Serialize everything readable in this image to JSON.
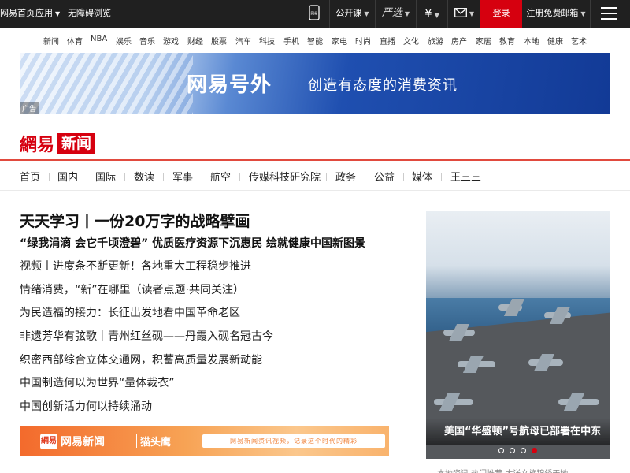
{
  "topbar": {
    "home": "网易首页",
    "apps": "应用",
    "accessible": "无障碍浏览",
    "phone_label": "网易",
    "open_course": "公开课",
    "yanxuan": "严选",
    "payment_symbol": "¥",
    "login": "登录",
    "register_mail": "注册免费邮箱"
  },
  "channels": [
    "新闻",
    "体育",
    "NBA",
    "娱乐",
    "音乐",
    "游戏",
    "财经",
    "股票",
    "汽车",
    "科技",
    "手机",
    "智能",
    "家电",
    "时尚",
    "直播",
    "文化",
    "旅游",
    "房产",
    "家居",
    "教育",
    "本地",
    "健康",
    "艺术"
  ],
  "banner": {
    "logo": "网易号外",
    "slogan": "创造有态度的消费资讯",
    "ad_label": "广告"
  },
  "brand": {
    "netease": "網易",
    "news": "新闻"
  },
  "sections": [
    "首页",
    "国内",
    "国际",
    "数读",
    "军事",
    "航空",
    "传媒科技研究院",
    "政务",
    "公益",
    "媒体",
    "王三三"
  ],
  "headlines": {
    "main": "天天学习丨一份20万字的战略擘画",
    "sub": "“绿我涓滴 会它千顷澄碧”   优质医疗资源下沉惠民 绘就健康中国新图景",
    "items": [
      "视频丨进度条不断更新！各地重大工程稳步推进",
      "情绪消费，“新”在哪里（读者点题·共同关注）",
      "为民造福的接力：长征出发地看中国革命老区",
      "非遗芳华有弦歌｜青州红丝砚——丹霞入砚名冠古今",
      "织密西部综合立体交通网，积蓄高质量发展新动能",
      "中国制造何以为世界“量体裁衣”",
      "中国创新活力何以持续涌动"
    ]
  },
  "promo": {
    "icon": "網易",
    "name": "网易新闻",
    "owl": "猫头鹰",
    "tagline": "网易新闻资讯视频，记录这个时代的精彩"
  },
  "photo": {
    "caption": "美国“华盛顿”号航母已部署在中东",
    "slides_total": 4,
    "active_slide": 4
  },
  "bottom_partial": "本地资讯  热门推荐  大洋文旅锦绣天地"
}
